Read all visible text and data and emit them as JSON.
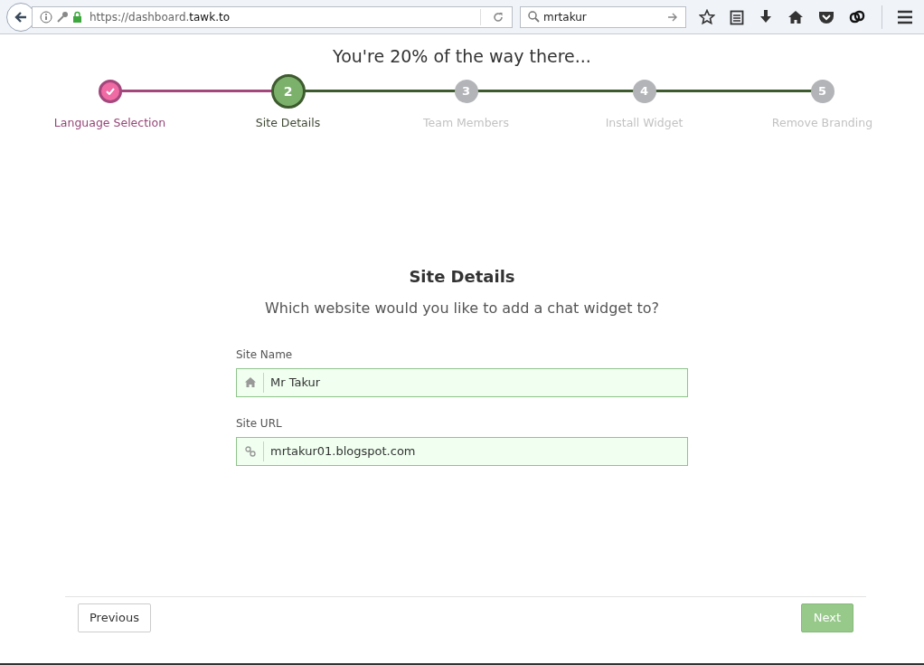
{
  "browser": {
    "url_prefix": "https://dashboard.",
    "url_domain": "tawk.to",
    "search": "mrtakur"
  },
  "progress_title": "You're 20% of the way there...",
  "steps": [
    {
      "kind": "done",
      "label": "Language Selection"
    },
    {
      "kind": "current",
      "number": "2",
      "label": "Site Details"
    },
    {
      "kind": "pending",
      "number": "3",
      "label": "Team Members"
    },
    {
      "kind": "pending",
      "number": "4",
      "label": "Install Widget"
    },
    {
      "kind": "pending",
      "number": "5",
      "label": "Remove Branding"
    }
  ],
  "heading": "Site Details",
  "subheading": "Which website would you like to add a chat widget to?",
  "fields": [
    {
      "kind": "home",
      "label": "Site Name",
      "value": "Mr Takur"
    },
    {
      "kind": "link",
      "label": "Site URL",
      "value": "mrtakur01.blogspot.com"
    }
  ],
  "buttons": {
    "previous": "Previous",
    "next": "Next"
  }
}
